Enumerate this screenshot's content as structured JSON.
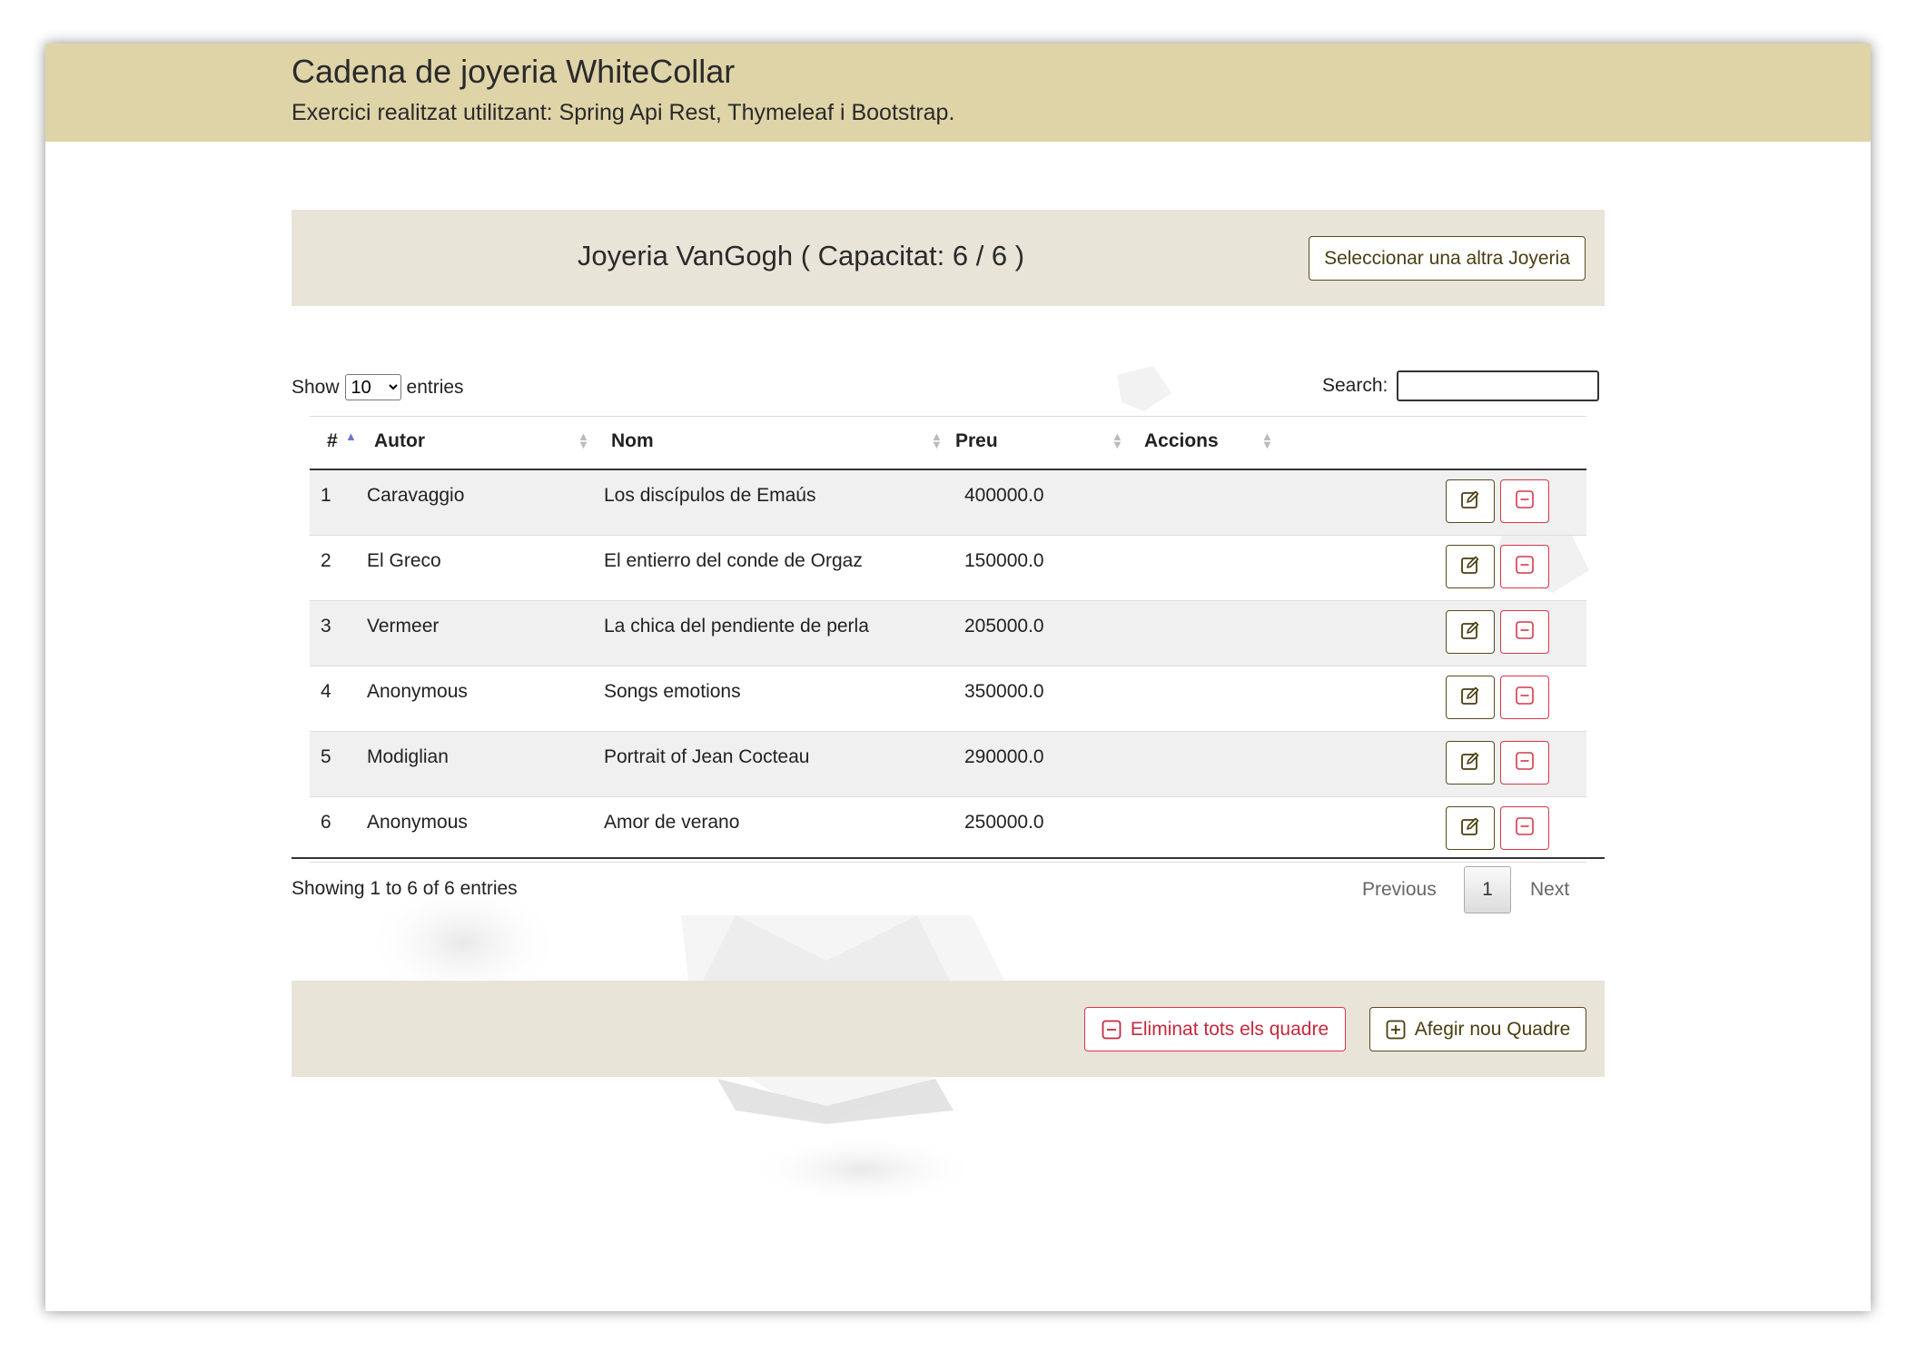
{
  "header": {
    "title": "Cadena de joyeria WhiteCollar",
    "subtitle": "Exercici realitzat utilitzant: Spring Api Rest, Thymeleaf i Bootstrap."
  },
  "card": {
    "title": "Joyeria VanGogh ( Capacitat: 6 / 6 )",
    "select_button": "Seleccionar una altra Joyeria"
  },
  "table_controls": {
    "show_label": "Show",
    "page_length": "10",
    "entries_label": "entries",
    "search_label": "Search:",
    "search_value": ""
  },
  "table": {
    "columns": [
      "#",
      "Autor",
      "Nom",
      "Preu",
      "Accions"
    ],
    "rows": [
      {
        "id": "1",
        "autor": "Caravaggio",
        "nom": "Los discípulos de Emaús",
        "preu": "400000.0"
      },
      {
        "id": "2",
        "autor": "El Greco",
        "nom": "El entierro del conde de Orgaz",
        "preu": "150000.0"
      },
      {
        "id": "3",
        "autor": "Vermeer",
        "nom": "La chica del pendiente de perla",
        "preu": "205000.0"
      },
      {
        "id": "4",
        "autor": "Anonymous",
        "nom": "Songs emotions",
        "preu": "350000.0"
      },
      {
        "id": "5",
        "autor": "Modiglian",
        "nom": "Portrait of Jean Cocteau",
        "preu": "290000.0"
      },
      {
        "id": "6",
        "autor": "Anonymous",
        "nom": "Amor de verano",
        "preu": "250000.0"
      }
    ],
    "row_actions": {
      "edit_icon": "edit-icon",
      "delete_icon": "minus-square-icon"
    }
  },
  "footer_table": {
    "info": "Showing 1 to 6 of 6 entries",
    "previous": "Previous",
    "current_page": "1",
    "next": "Next"
  },
  "card_footer": {
    "delete_all_label": "Eliminat tots els quadre",
    "add_label": "Afegir nou Quadre"
  },
  "colors": {
    "header_bg": "#dfd4a8",
    "card_bg": "#e8e4d8",
    "accent": "#5a4a1e",
    "danger": "#d8364a"
  }
}
